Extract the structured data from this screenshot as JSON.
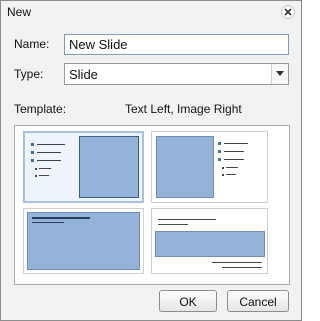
{
  "dialog": {
    "title": "New",
    "close_icon": "close-icon"
  },
  "form": {
    "name_label": "Name:",
    "name_value": "New Slide",
    "type_label": "Type:",
    "type_value": "Slide",
    "template_label": "Template:",
    "template_selected_name": "Text Left, Image Right"
  },
  "templates": [
    {
      "name": "Text Left, Image Right",
      "selected": true
    },
    {
      "name": "Image Left, Text Right",
      "selected": false
    },
    {
      "name": "Title and Image",
      "selected": false
    },
    {
      "name": "Title, Image Band and Text",
      "selected": false
    }
  ],
  "buttons": {
    "ok": "OK",
    "cancel": "Cancel"
  }
}
